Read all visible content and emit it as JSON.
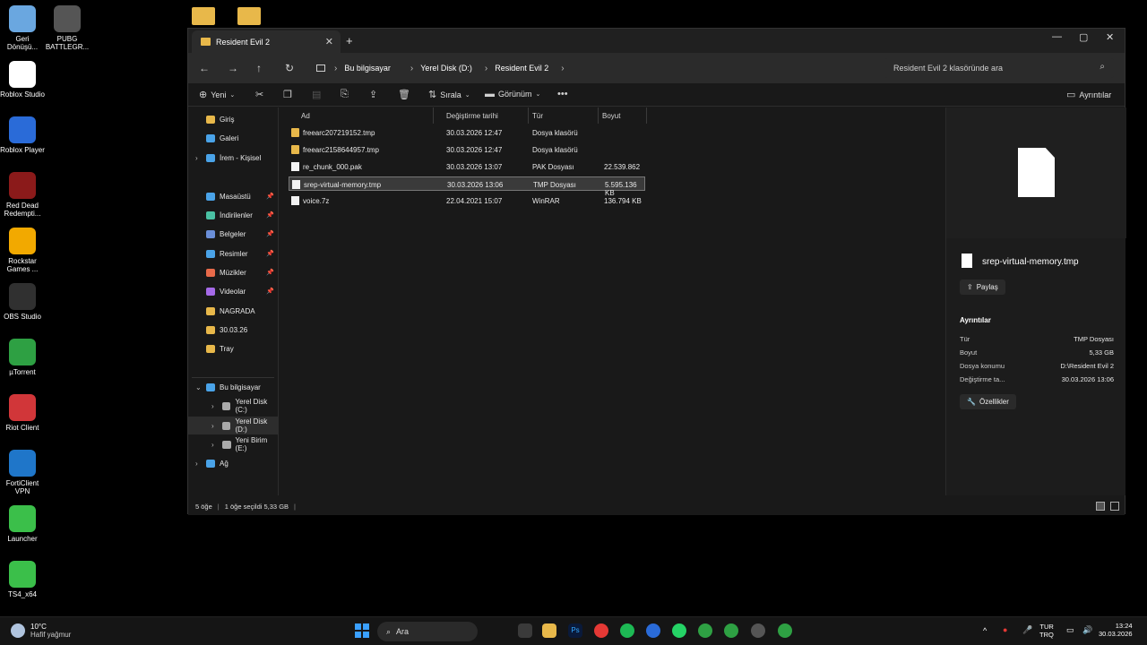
{
  "desktop": {
    "icons": [
      {
        "label": "Geri Dönüşü...",
        "icon": "recycle-bin-icon",
        "color": "#6aa7e0"
      },
      {
        "label": "PUBG BATTLEGR...",
        "icon": "pubg-icon",
        "color": "#555555"
      },
      {
        "label": "Roblox Studio",
        "icon": "roblox-studio-icon",
        "color": "#ffffff"
      },
      {
        "label": "Roblox Player",
        "icon": "roblox-player-icon",
        "color": "#2a6bd8"
      },
      {
        "label": "Red Dead Redempti...",
        "icon": "red-dead-icon",
        "color": "#8b1a1a"
      },
      {
        "label": "Rockstar Games ...",
        "icon": "rockstar-icon",
        "color": "#f2a900"
      },
      {
        "label": "OBS Studio",
        "icon": "obs-icon",
        "color": "#303030"
      },
      {
        "label": "µTorrent",
        "icon": "utorrent-icon",
        "color": "#2ea043"
      },
      {
        "label": "Riot Client",
        "icon": "riot-client-icon",
        "color": "#d13639"
      },
      {
        "label": "FortiClient VPN",
        "icon": "forticlient-icon",
        "color": "#1f76c9"
      },
      {
        "label": "Launcher",
        "icon": "launcher-icon",
        "color": "#3bbf4a"
      },
      {
        "label": "TS4_x64",
        "icon": "sims4-icon",
        "color": "#3bbf4a"
      }
    ]
  },
  "window": {
    "tab_title": "Resident Evil 2",
    "nav": {
      "breadcrumbs": [
        "Bu bilgisayar",
        "Yerel Disk (D:)",
        "Resident Evil 2"
      ],
      "search_placeholder": "Resident Evil 2 klasöründe ara"
    },
    "toolbar": {
      "new_label": "Yeni",
      "sort_label": "Sırala",
      "view_label": "Görünüm",
      "details_label": "Ayrıntılar"
    },
    "sidebar": {
      "items": [
        {
          "label": "Giriş",
          "icon": "home-icon",
          "color": "#e8b84a"
        },
        {
          "label": "Galeri",
          "icon": "gallery-icon",
          "color": "#4aa3e8"
        },
        {
          "label": "İrem - Kişisel",
          "icon": "onedrive-icon",
          "color": "#4aa3e8"
        },
        {
          "label": "Masaüstü",
          "icon": "desktop-icon",
          "color": "#4aa3e8"
        },
        {
          "label": "İndirilenler",
          "icon": "downloads-icon",
          "color": "#4ac1a3"
        },
        {
          "label": "Belgeler",
          "icon": "documents-icon",
          "color": "#6a8ed8"
        },
        {
          "label": "Resimler",
          "icon": "pictures-icon",
          "color": "#4aa3e8"
        },
        {
          "label": "Müzikler",
          "icon": "music-icon",
          "color": "#e86a4a"
        },
        {
          "label": "Videolar",
          "icon": "videos-icon",
          "color": "#a56ae8"
        },
        {
          "label": "NAGRADA",
          "icon": "folder-icon",
          "color": "#e8b84a"
        },
        {
          "label": "30.03.26",
          "icon": "folder-icon",
          "color": "#e8b84a"
        },
        {
          "label": "Tray",
          "icon": "folder-icon",
          "color": "#e8b84a"
        },
        {
          "label": "Bu bilgisayar",
          "icon": "computer-icon",
          "color": "#4aa3e8"
        },
        {
          "label": "Yerel Disk (C:)",
          "icon": "drive-icon",
          "color": "#aaaaaa"
        },
        {
          "label": "Yerel Disk (D:)",
          "icon": "drive-icon",
          "color": "#aaaaaa"
        },
        {
          "label": "Yeni Birim (E:)",
          "icon": "drive-icon",
          "color": "#aaaaaa"
        },
        {
          "label": "Ağ",
          "icon": "network-icon",
          "color": "#4aa3e8"
        }
      ]
    },
    "columns": [
      "Ad",
      "Değiştirme tarihi",
      "Tür",
      "Boyut"
    ],
    "files": [
      {
        "name": "freearc207219152.tmp",
        "date": "30.03.2026 12:47",
        "type": "Dosya klasörü",
        "size": "",
        "kind": "folder"
      },
      {
        "name": "freearc2158644957.tmp",
        "date": "30.03.2026 12:47",
        "type": "Dosya klasörü",
        "size": "",
        "kind": "folder"
      },
      {
        "name": "re_chunk_000.pak",
        "date": "30.03.2026 13:07",
        "type": "PAK Dosyası",
        "size": "22.539.862 ...",
        "kind": "file"
      },
      {
        "name": "srep-virtual-memory.tmp",
        "date": "30.03.2026 13:06",
        "type": "TMP Dosyası",
        "size": "5.595.136 KB",
        "kind": "file",
        "selected": true
      },
      {
        "name": "voice.7z",
        "date": "22.04.2021 15:07",
        "type": "WinRAR",
        "size": "136.794 KB",
        "kind": "file"
      }
    ],
    "details_pane": {
      "file_name": "srep-virtual-memory.tmp",
      "share_label": "Paylaş",
      "section_title": "Ayrıntılar",
      "rows": [
        {
          "key": "Tür",
          "value": "TMP Dosyası"
        },
        {
          "key": "Boyut",
          "value": "5,33 GB"
        },
        {
          "key": "Dosya konumu",
          "value": "D:\\Resident Evil 2"
        },
        {
          "key": "Değiştirme ta...",
          "value": "30.03.2026 13:06"
        }
      ],
      "properties_label": "Özellikler"
    },
    "status": {
      "count": "5 öğe",
      "selected": "1 öğe seçildi  5,33 GB"
    }
  },
  "taskbar": {
    "weather_temp": "10°C",
    "weather_desc": "Hafif yağmur",
    "search_label": "Ara",
    "lang_top": "TUR",
    "lang_bottom": "TRQ",
    "time": "13:24",
    "date": "30.03.2026"
  }
}
